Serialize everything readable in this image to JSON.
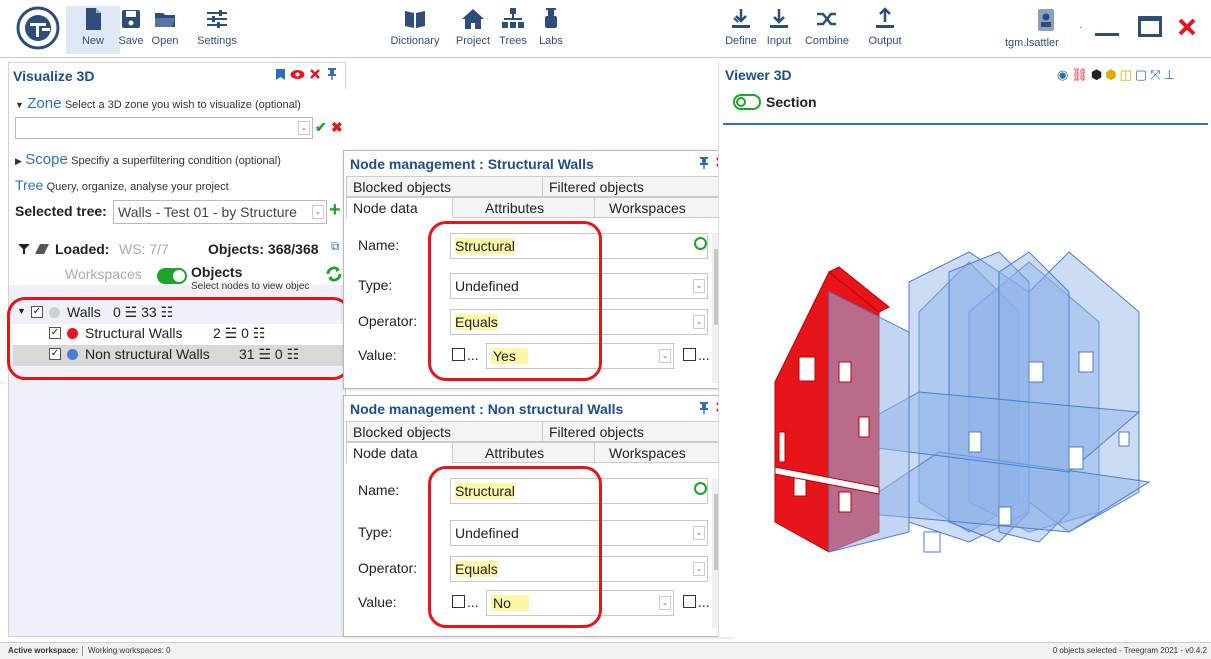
{
  "toolbar": {
    "left": [
      {
        "label": "New",
        "icon": "new-file-icon",
        "active": true
      },
      {
        "label": "Save",
        "icon": "save-icon"
      },
      {
        "label": "Open",
        "icon": "open-folder-icon"
      },
      {
        "label": "Settings",
        "icon": "settings-sliders-icon"
      }
    ],
    "center": [
      {
        "label": "Dictionary",
        "icon": "dictionary-icon"
      },
      {
        "label": "Project",
        "icon": "home-icon"
      },
      {
        "label": "Trees",
        "icon": "tree-icon"
      },
      {
        "label": "Labs",
        "icon": "labs-icon"
      }
    ],
    "right": [
      {
        "label": "Define",
        "icon": "define-icon"
      },
      {
        "label": "Input",
        "icon": "input-icon"
      },
      {
        "label": "Combine",
        "icon": "combine-icon"
      },
      {
        "label": "Output",
        "icon": "output-icon"
      }
    ],
    "user": "tgm.lsattler"
  },
  "visualize": {
    "title": "Visualize 3D",
    "zone_label": "Zone",
    "zone_desc": "Select a 3D zone you wish to visualize (optional)",
    "zone_value": "",
    "scope_label": "Scope",
    "scope_desc": "Specifiy a superfiltering condition (optional)",
    "tree_label": "Tree",
    "tree_desc": "Query, organize, analyse your project",
    "selected_tree_label": "Selected tree:",
    "selected_tree_value": "Walls - Test 01 - by Structure",
    "loaded_label": "Loaded:",
    "loaded_value": "WS: 7/7",
    "objects_label": "Objects: 368/368",
    "workspaces_label": "Workspaces",
    "objects_toggle_label": "Objects",
    "objects_toggle_desc": "Select nodes to view objec",
    "tree": [
      {
        "label": "Walls",
        "counts": "0 ☱ 33 ☷",
        "level": 0,
        "dot": "#d0d0d0"
      },
      {
        "label": "Structural Walls",
        "counts": "2 ☱ 0 ☷",
        "level": 1,
        "dot": "#e8141c"
      },
      {
        "label": "Non structural Walls",
        "counts": "31 ☱ 0 ☷",
        "level": 1,
        "dot": "#4a7fcf"
      }
    ]
  },
  "node_panels": [
    {
      "title": "Node management : Structural Walls",
      "tabs_top": [
        "Blocked objects",
        "Filtered objects"
      ],
      "tabs_bottom": [
        "Node data",
        "Attributes",
        "Workspaces"
      ],
      "name_label": "Name:",
      "name_value": "Structural",
      "type_label": "Type:",
      "type_value": "Undefined",
      "operator_label": "Operator:",
      "operator_value": "Equals",
      "value_label": "Value:",
      "value_value": "Yes",
      "check_suffix": "..."
    },
    {
      "title": "Node management : Non structural Walls",
      "tabs_top": [
        "Blocked objects",
        "Filtered objects"
      ],
      "tabs_bottom": [
        "Node data",
        "Attributes",
        "Workspaces"
      ],
      "name_label": "Name:",
      "name_value": "Structural",
      "type_label": "Type:",
      "type_value": "Undefined",
      "operator_label": "Operator:",
      "operator_value": "Equals",
      "value_label": "Value:",
      "value_value": "No",
      "check_suffix": "..."
    }
  ],
  "viewer": {
    "title": "Viewer 3D",
    "section_label": "Section"
  },
  "status": {
    "active_workspace": "Active workspace:",
    "working_workspaces": "Working workspaces: 0",
    "right": "0 objects selected  -  Treegram 2021 - v0.4.2"
  },
  "colors": {
    "accent": "#1f4e8c",
    "red": "#e8141c",
    "green": "#1fa22a",
    "highlight": "#fff6a8"
  }
}
